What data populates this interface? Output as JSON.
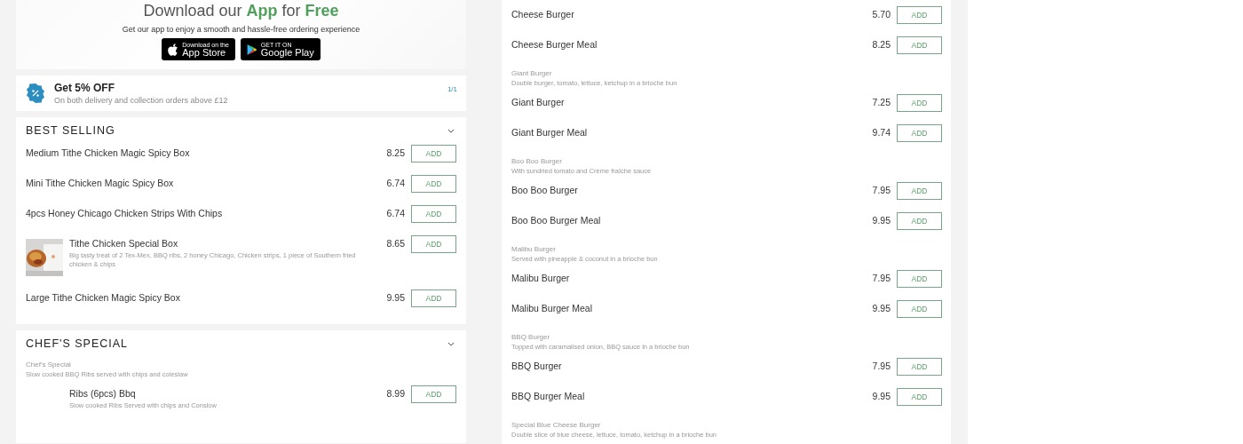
{
  "app_banner": {
    "title": [
      {
        "text": "Download our",
        "accent": false
      },
      {
        "text": "App",
        "accent": true
      },
      {
        "text": "for",
        "accent": false
      },
      {
        "text": "Free",
        "accent": true
      }
    ],
    "subtitle": "Get our app to enjoy a smooth and hassle-free ordering experience",
    "badges": [
      {
        "kind": "apple",
        "small": "Download on the",
        "big": "App Store"
      },
      {
        "kind": "google",
        "small": "GET IT ON",
        "big": "Google Play"
      }
    ]
  },
  "offer": {
    "title": "Get 5% OFF",
    "text": "On both delivery and collection orders above £12",
    "counter": "1/1"
  },
  "sections": [
    {
      "title": "BEST SELLING",
      "expanded": true,
      "entries": [
        {
          "kind": "plain",
          "name": "Medium Tithe Chicken Magic Spicy Box",
          "price": "8.25",
          "button": "ADD"
        },
        {
          "kind": "plain",
          "name": "Mini Tithe Chicken Magic Spicy Box",
          "price": "6.74",
          "button": "ADD"
        },
        {
          "kind": "plain",
          "name": "4pcs Honey Chicago Chicken Strips With Chips",
          "price": "6.74",
          "button": "ADD"
        },
        {
          "kind": "media",
          "name": "Tithe Chicken Special Box",
          "description": "Big tasty treat of 2 Tex-Mex, BBQ ribs, 2 honey Chicago, Chicken strips, 1 piece of Southern fried chicken & chips",
          "price": "8.65",
          "button": "ADD"
        },
        {
          "kind": "plain",
          "name": "Large Tithe Chicken Magic Spicy Box",
          "price": "9.95",
          "button": "ADD"
        }
      ]
    },
    {
      "title": "CHEF'S SPECIAL",
      "expanded": true,
      "entries": [
        {
          "kind": "group",
          "name": "Chef's Special",
          "description": "Slow cooked BBQ Ribs served with chips and coleslaw"
        },
        {
          "kind": "indented",
          "name": "Ribs (6pcs) Bbq",
          "description": "Slow cooked Ribs Served with chips and Conslow",
          "price": "8.99",
          "button": "ADD"
        }
      ]
    }
  ],
  "menu": [
    {
      "kind": "plain",
      "name": "Cheese Burger",
      "price": "5.70",
      "button": "ADD"
    },
    {
      "kind": "plain",
      "name": "Cheese Burger Meal",
      "price": "8.25",
      "button": "ADD"
    },
    {
      "kind": "group",
      "name": "Giant Burger",
      "description": "Double burger, tomato, lettuce, ketchup in a brioche bun"
    },
    {
      "kind": "plain",
      "name": "Giant Burger",
      "price": "7.25",
      "button": "ADD"
    },
    {
      "kind": "plain",
      "name": "Giant Burger Meal",
      "price": "9.74",
      "button": "ADD"
    },
    {
      "kind": "group",
      "name": "Boo Boo Burger",
      "description": "With sundried tomato and Crème fraîche sauce"
    },
    {
      "kind": "plain",
      "name": "Boo Boo Burger",
      "price": "7.95",
      "button": "ADD"
    },
    {
      "kind": "plain",
      "name": "Boo Boo Burger Meal",
      "price": "9.95",
      "button": "ADD"
    },
    {
      "kind": "group",
      "name": "Malibu Burger",
      "description": "Served with pineapple & coconut in a brioche bun"
    },
    {
      "kind": "plain",
      "name": "Malibu Burger",
      "price": "7.95",
      "button": "ADD"
    },
    {
      "kind": "plain",
      "name": "Malibu Burger Meal",
      "price": "9.95",
      "button": "ADD"
    },
    {
      "kind": "group",
      "name": "BBQ Burger",
      "description": "Topped with caramalised onion, BBQ sauce in a brioche bun"
    },
    {
      "kind": "plain",
      "name": "BBQ Burger",
      "price": "7.95",
      "button": "ADD"
    },
    {
      "kind": "plain",
      "name": "BBQ Burger Meal",
      "price": "9.95",
      "button": "ADD"
    },
    {
      "kind": "group",
      "name": "Special Blue Cheese Burger",
      "description": "Double slice of blue cheese, lettuce, tomato, ketchup in a brioche bun"
    }
  ]
}
